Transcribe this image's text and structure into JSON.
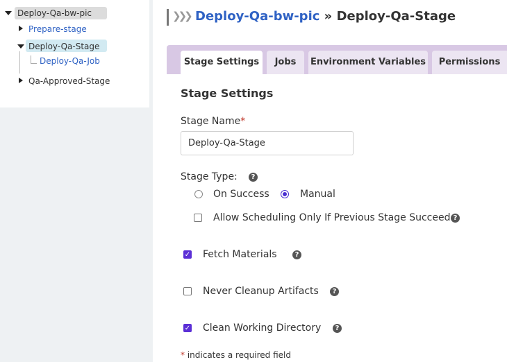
{
  "tree": {
    "root": "Deploy-Qa-bw-pic",
    "stages": [
      {
        "label": "Prepare-stage"
      },
      {
        "label": "Deploy-Qa-Stage"
      },
      {
        "label": "Qa-Approved-Stage"
      }
    ],
    "job": "Deploy-Qa-Job"
  },
  "header": {
    "pipeline": "Deploy-Qa-bw-pic",
    "separator": " » ",
    "stage": "Deploy-Qa-Stage",
    "arrows": "❯❯❯"
  },
  "tabs": [
    "Stage Settings",
    "Jobs",
    "Environment Variables",
    "Permissions"
  ],
  "form": {
    "section_title": "Stage Settings",
    "stage_name_label": "Stage Name",
    "required_mark": "*",
    "stage_name_value": "Deploy-Qa-Stage",
    "stage_type_label": "Stage Type:",
    "radio_on_success": "On Success",
    "radio_manual": "Manual",
    "allow_scheduling": "Allow Scheduling Only If Previous Stage Succeed",
    "fetch_materials": "Fetch Materials",
    "never_cleanup": "Never Cleanup Artifacts",
    "clean_working_dir": "Clean Working Directory",
    "required_note": "indicates a required field",
    "help_glyph": "?",
    "check_glyph": "✓"
  },
  "colors": {
    "link": "#2f62c4",
    "tab_bar": "#d8c8e4",
    "checkbox_checked": "#5b2fd6",
    "selected_node": "#d2eaf2"
  }
}
